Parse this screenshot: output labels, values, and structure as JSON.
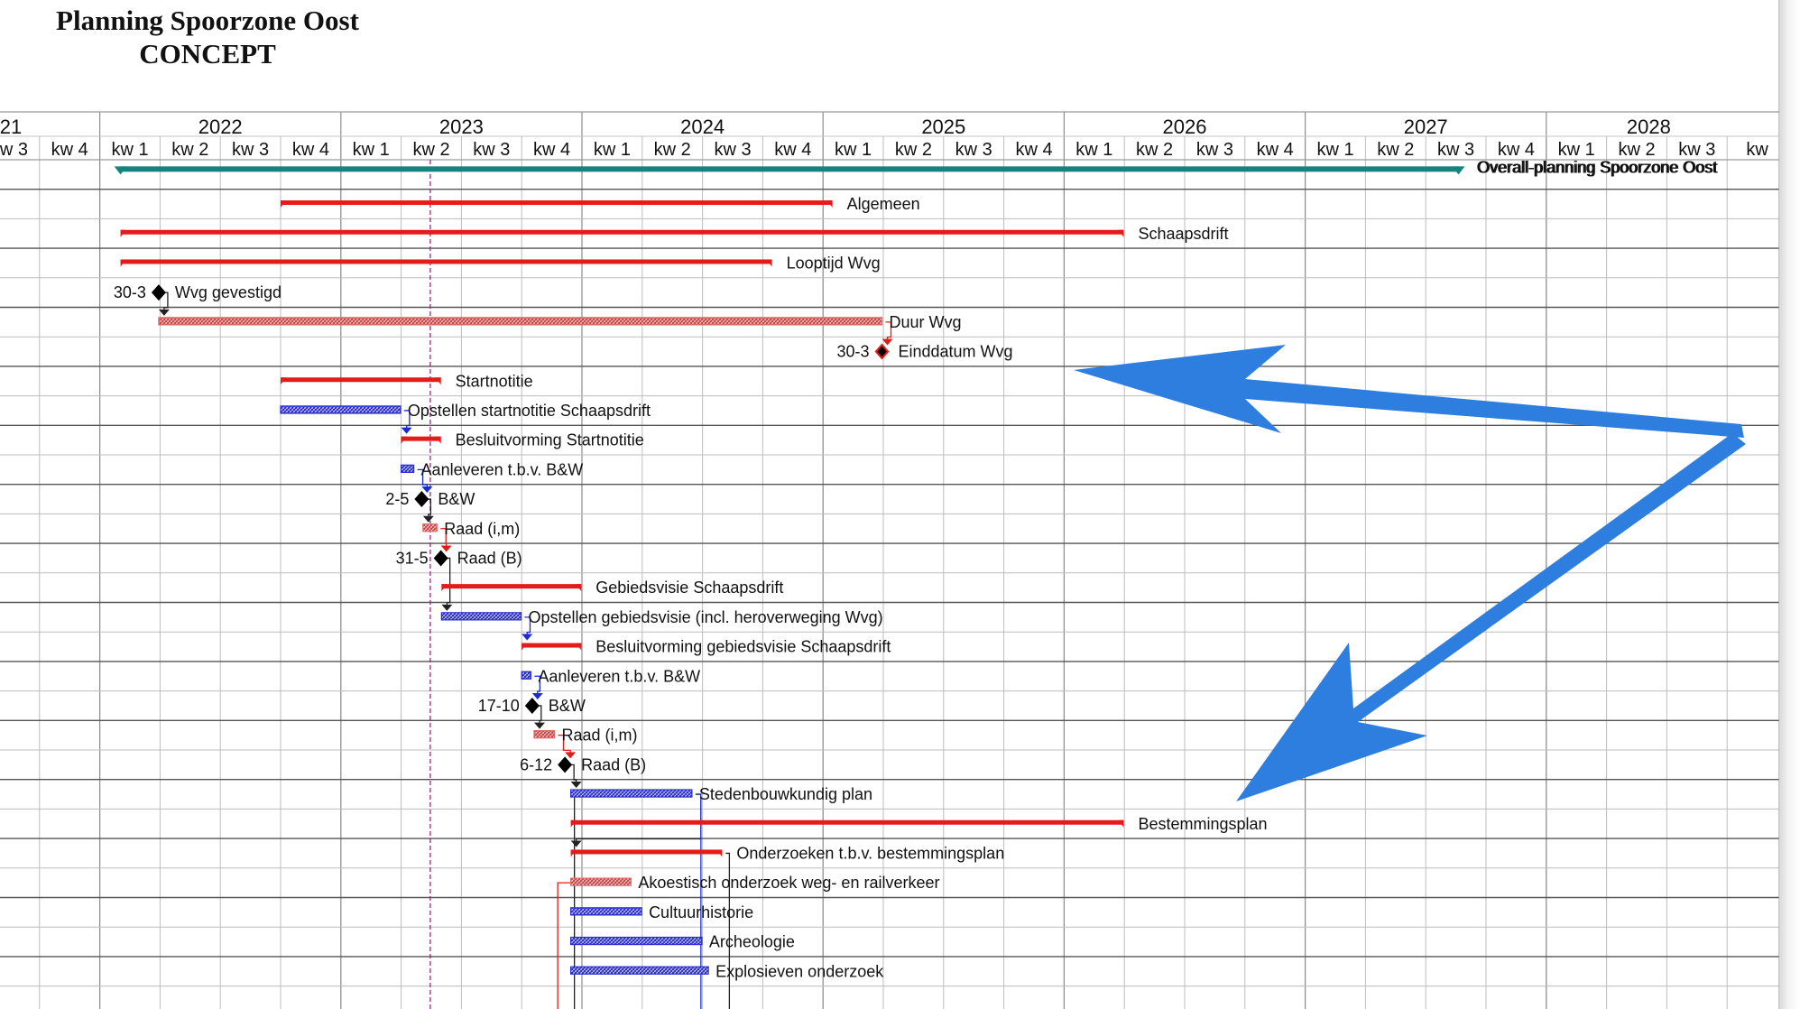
{
  "title": {
    "line1": "Planning Spoorzone Oost",
    "line2": "CONCEPT"
  },
  "chart_data": {
    "type": "gantt",
    "time_axis": {
      "first_year_fragment": "21",
      "years": [
        "2022",
        "2023",
        "2024",
        "2025",
        "2026",
        "2027",
        "2028"
      ],
      "quarter_labels": [
        "kw 3",
        "kw 4",
        "kw 1",
        "kw 2",
        "kw 3",
        "kw 4",
        "kw 1",
        "kw 2",
        "kw 3",
        "kw 4",
        "kw 1",
        "kw 2",
        "kw 3",
        "kw 4",
        "kw 1",
        "kw 2",
        "kw 3",
        "kw 4",
        "kw 1",
        "kw 2",
        "kw 3",
        "kw 4",
        "kw 1",
        "kw 2",
        "kw 3",
        "kw 4",
        "kw 1",
        "kw 2",
        "kw 3",
        "kw"
      ],
      "start": "2021-07-01",
      "end": "2028-12-31"
    },
    "today_line": "2023-05-15",
    "colors": {
      "summary": "#e31b1b",
      "task": "#2b2fd0",
      "task_critical": "#e06a6a",
      "milestone": "#000000",
      "project_summary": "#14847c",
      "link": "#222222",
      "link_blue": "#1a2bd6",
      "link_red": "#e31b1b",
      "today": "#8a2a8a",
      "annotation_arrow": "#2e7ee0"
    },
    "tasks": [
      {
        "name": "Overall-planning Spoorzone Oost",
        "start": "2022-02-01",
        "end": "2027-08-20",
        "kind": "project"
      },
      {
        "name": "Algemeen",
        "start": "2022-10-01",
        "end": "2025-01-15",
        "kind": "summary"
      },
      {
        "name": "Schaapsdrift",
        "start": "2022-02-01",
        "end": "2026-03-31",
        "kind": "summary"
      },
      {
        "name": "Looptijd Wvg",
        "start": "2022-02-01",
        "end": "2024-10-15",
        "kind": "summary"
      },
      {
        "name": "Wvg gevestigd",
        "date": "2022-03-30",
        "date_label": "30-3",
        "kind": "milestone"
      },
      {
        "name": "Duur Wvg",
        "start": "2022-03-30",
        "end": "2025-03-30",
        "kind": "critical"
      },
      {
        "name": "Einddatum Wvg",
        "date": "2025-03-30",
        "date_label": "30-3",
        "kind": "milestone_critical"
      },
      {
        "name": "Startnotitie",
        "start": "2022-10-01",
        "end": "2023-05-31",
        "kind": "summary"
      },
      {
        "name": "Opstellen startnotitie Schaapsdrift",
        "start": "2022-10-01",
        "end": "2023-03-31",
        "kind": "task"
      },
      {
        "name": "Besluitvorming Startnotitie",
        "start": "2023-04-01",
        "end": "2023-05-31",
        "kind": "summary"
      },
      {
        "name": "Aanleveren t.b.v. B&W",
        "start": "2023-04-01",
        "end": "2023-04-20",
        "kind": "task"
      },
      {
        "name": "B&W",
        "date": "2023-05-02",
        "date_label": "2-5",
        "kind": "milestone"
      },
      {
        "name": "Raad (i,m)",
        "start": "2023-05-04",
        "end": "2023-05-25",
        "kind": "critical"
      },
      {
        "name": "Raad (B)",
        "date": "2023-05-31",
        "date_label": "31-5",
        "kind": "milestone"
      },
      {
        "name": "Gebiedsvisie Schaapsdrift",
        "start": "2023-06-01",
        "end": "2023-12-31",
        "kind": "summary"
      },
      {
        "name": "Opstellen gebiedsvisie (incl. heroverweging Wvg)",
        "start": "2023-06-01",
        "end": "2023-09-30",
        "kind": "task"
      },
      {
        "name": "Besluitvorming gebiedsvisie Schaapsdrift",
        "start": "2023-10-01",
        "end": "2023-12-31",
        "kind": "summary"
      },
      {
        "name": "Aanleveren t.b.v. B&W",
        "start": "2023-10-01",
        "end": "2023-10-15",
        "kind": "task"
      },
      {
        "name": "B&W",
        "date": "2023-10-17",
        "date_label": "17-10",
        "kind": "milestone"
      },
      {
        "name": "Raad (i,m)",
        "start": "2023-10-20",
        "end": "2023-11-20",
        "kind": "critical"
      },
      {
        "name": "Raad (B)",
        "date": "2023-12-06",
        "date_label": "6-12",
        "kind": "milestone"
      },
      {
        "name": "Stedenbouwkundig plan",
        "start": "2023-12-15",
        "end": "2024-06-15",
        "kind": "task"
      },
      {
        "name": "Bestemmingsplan",
        "start": "2023-12-15",
        "end": "2026-03-31",
        "kind": "summary"
      },
      {
        "name": "Onderzoeken t.b.v. bestemmingsplan",
        "start": "2023-12-15",
        "end": "2024-07-31",
        "kind": "summary"
      },
      {
        "name": "Akoestisch onderzoek weg- en railverkeer",
        "start": "2023-12-15",
        "end": "2024-03-15",
        "kind": "critical"
      },
      {
        "name": "Cultuurhistorie",
        "start": "2023-12-15",
        "end": "2024-03-31",
        "kind": "task"
      },
      {
        "name": "Archeologie",
        "start": "2023-12-15",
        "end": "2024-06-30",
        "kind": "task"
      },
      {
        "name": "Explosieven onderzoek",
        "start": "2023-12-15",
        "end": "2024-07-10",
        "kind": "task"
      }
    ],
    "grid": true
  }
}
